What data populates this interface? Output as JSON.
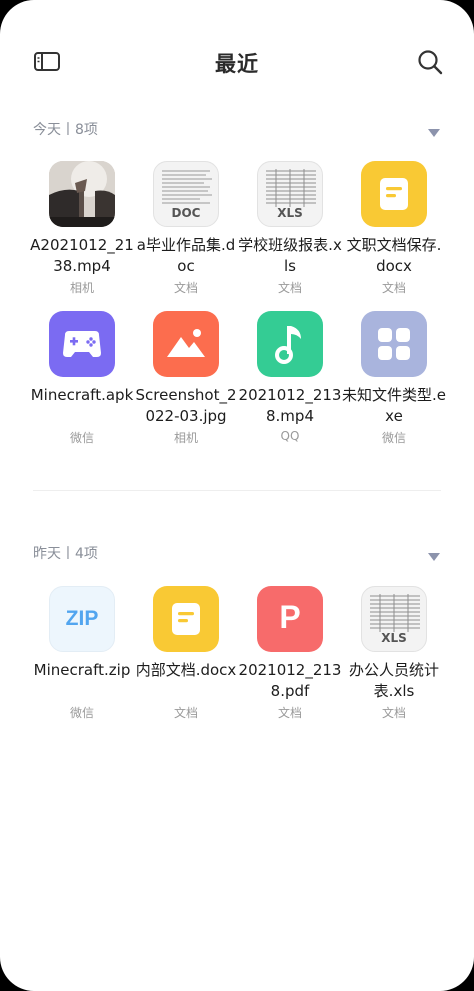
{
  "header": {
    "title": "最近",
    "menu_icon": "sidebar-toggle-icon",
    "search_icon": "search-icon"
  },
  "sections": [
    {
      "label": "今天丨8项",
      "items": [
        {
          "name": "A2021012_2138.mp4",
          "source": "相机",
          "icon": "video-thumbnail"
        },
        {
          "name": "a毕业作品集.doc",
          "source": "文档",
          "icon": "doc-thumbnail",
          "badge": "DOC"
        },
        {
          "name": "学校班级报表.xls",
          "source": "文档",
          "icon": "xls-thumbnail",
          "badge": "XLS"
        },
        {
          "name": "文职文档保存.docx",
          "source": "文档",
          "icon": "docx-icon"
        },
        {
          "name": "Minecraft.apk",
          "source": "微信",
          "icon": "gamepad-icon"
        },
        {
          "name": "Screenshot_2022-03.jpg",
          "source": "相机",
          "icon": "image-icon"
        },
        {
          "name": "2021012_2138.mp4",
          "source": "QQ",
          "icon": "music-note-icon"
        },
        {
          "name": "未知文件类型.exe",
          "source": "微信",
          "icon": "unknown-file-icon"
        }
      ]
    },
    {
      "label": "昨天丨4项",
      "items": [
        {
          "name": "Minecraft.zip",
          "source": "微信",
          "icon": "zip-icon",
          "badge": "ZIP"
        },
        {
          "name": "内部文档.docx",
          "source": "文档",
          "icon": "docx-icon"
        },
        {
          "name": "2021012_2138.pdf",
          "source": "文档",
          "icon": "pdf-icon",
          "badge": "P"
        },
        {
          "name": "办公人员统计表.xls",
          "source": "文档",
          "icon": "xls-thumbnail",
          "badge": "XLS"
        }
      ]
    }
  ],
  "colors": {
    "docx": "#f9c934",
    "apk": "#7b6bf2",
    "image": "#fc6d4e",
    "audio": "#34cc94",
    "unknown": "#a9b4dd",
    "zip_bg": "#edf6fd",
    "zip_text": "#52a5ef",
    "pdf": "#f76b6b",
    "section_arrow": "#8c93ac"
  }
}
